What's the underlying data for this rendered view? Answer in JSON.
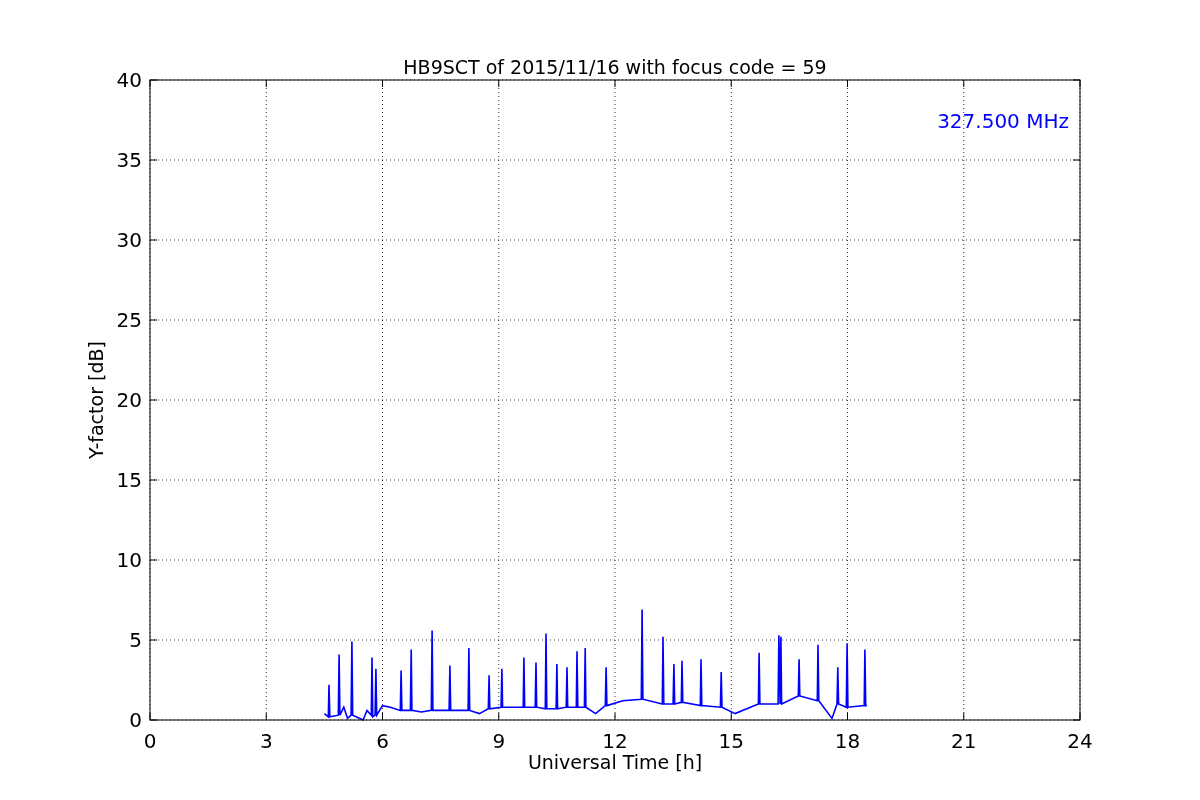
{
  "chart_data": {
    "type": "line",
    "title": "HB9SCT of 2015/11/16 with focus code = 59",
    "xlabel": "Universal Time [h]",
    "ylabel": "Y-factor [dB]",
    "xlim": [
      0,
      24
    ],
    "ylim": [
      0,
      40
    ],
    "xticks": [
      0,
      3,
      6,
      9,
      12,
      15,
      18,
      21,
      24
    ],
    "yticks": [
      0,
      5,
      10,
      15,
      20,
      25,
      30,
      35,
      40
    ],
    "x": [
      4.5,
      4.6,
      4.62,
      4.64,
      4.86,
      4.88,
      4.9,
      5.0,
      5.1,
      5.19,
      5.21,
      5.23,
      5.5,
      5.6,
      5.71,
      5.73,
      5.75,
      5.81,
      5.83,
      5.85,
      6.0,
      6.2,
      6.46,
      6.48,
      6.5,
      6.72,
      6.74,
      6.76,
      7.0,
      7.26,
      7.28,
      7.3,
      7.72,
      7.74,
      7.76,
      8.21,
      8.23,
      8.25,
      8.5,
      8.73,
      8.75,
      8.77,
      9.06,
      9.08,
      9.1,
      9.63,
      9.65,
      9.67,
      9.94,
      9.96,
      9.98,
      10.2,
      10.22,
      10.24,
      10.48,
      10.5,
      10.52,
      10.74,
      10.76,
      10.78,
      11.0,
      11.02,
      11.04,
      11.21,
      11.23,
      11.25,
      11.5,
      11.75,
      11.77,
      11.79,
      12.2,
      12.68,
      12.7,
      12.72,
      13.22,
      13.24,
      13.26,
      13.5,
      13.52,
      13.54,
      13.71,
      13.73,
      13.75,
      14.2,
      14.22,
      14.24,
      14.72,
      14.74,
      14.76,
      15.1,
      15.7,
      15.72,
      15.74,
      16.21,
      16.23,
      16.26,
      16.28,
      16.3,
      16.73,
      16.75,
      16.77,
      17.22,
      17.24,
      17.26,
      17.6,
      17.73,
      17.75,
      17.77,
      17.97,
      17.99,
      18.01,
      18.43,
      18.45,
      18.47,
      18.5
    ],
    "series": [
      {
        "color": "#0000ff",
        "values": [
          0.4,
          0.2,
          2.2,
          0.2,
          0.3,
          4.1,
          0.3,
          0.8,
          0.1,
          0.3,
          4.9,
          0.3,
          0.0,
          0.6,
          0.3,
          3.9,
          0.2,
          0.3,
          3.2,
          0.3,
          0.9,
          0.8,
          0.6,
          3.1,
          0.6,
          0.6,
          4.4,
          0.6,
          0.5,
          0.6,
          5.6,
          0.6,
          0.6,
          3.4,
          0.6,
          0.6,
          4.5,
          0.6,
          0.4,
          0.7,
          2.8,
          0.7,
          0.8,
          3.2,
          0.8,
          0.8,
          3.9,
          0.8,
          0.8,
          3.6,
          0.8,
          0.7,
          5.4,
          0.7,
          0.7,
          3.5,
          0.7,
          0.8,
          3.3,
          0.8,
          0.8,
          4.3,
          0.8,
          0.8,
          4.5,
          0.8,
          0.4,
          0.9,
          3.3,
          0.9,
          1.2,
          1.3,
          6.9,
          1.3,
          1.0,
          5.2,
          1.0,
          1.0,
          3.5,
          1.0,
          1.1,
          3.7,
          1.1,
          0.9,
          3.8,
          0.9,
          0.8,
          3.0,
          0.8,
          0.4,
          1.0,
          4.2,
          1.0,
          1.0,
          5.3,
          1.0,
          5.2,
          1.0,
          1.5,
          3.8,
          1.5,
          1.2,
          4.7,
          1.2,
          0.1,
          1.0,
          3.3,
          1.0,
          0.8,
          4.8,
          0.8,
          0.9,
          4.4,
          0.9,
          0.9
        ]
      }
    ],
    "grid": true,
    "annotations": [
      "327.500 MHz"
    ]
  }
}
